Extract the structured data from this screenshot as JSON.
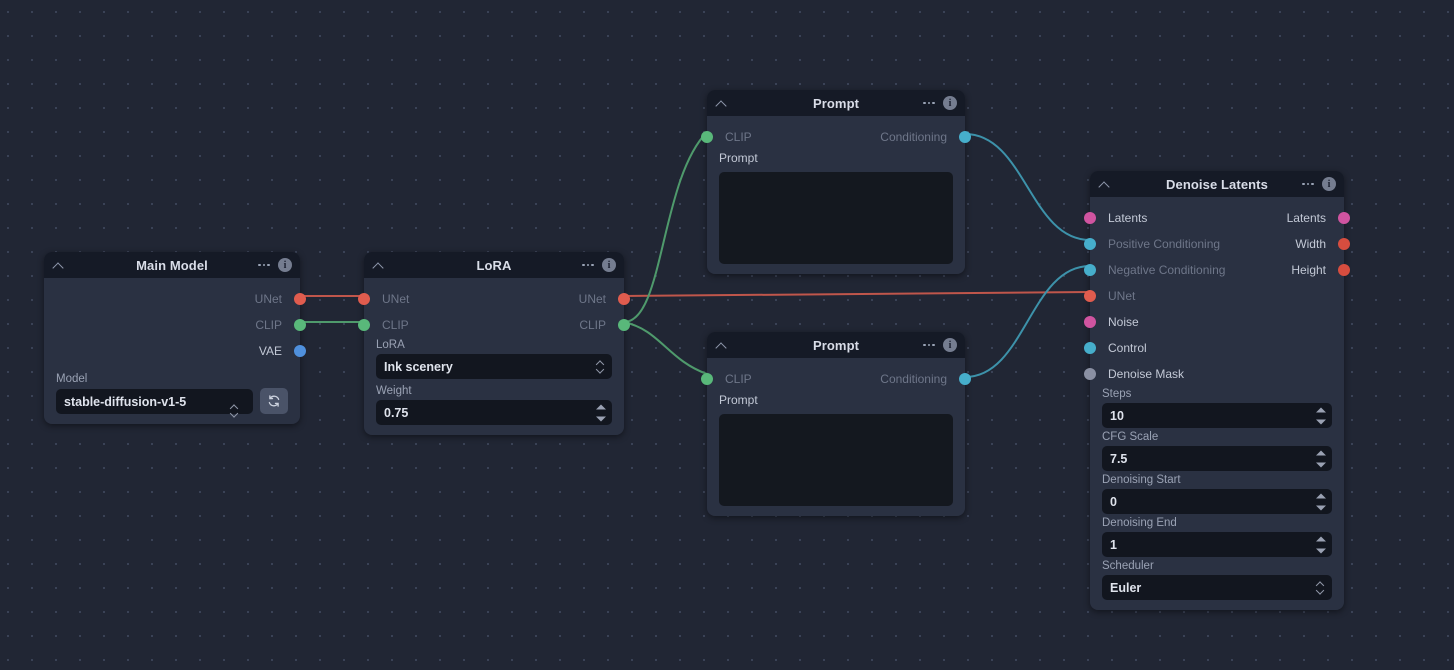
{
  "canvas": {
    "background_color": "#212634",
    "grid_dot_color": "#3a4256"
  },
  "socket_colors": {
    "unet": "#e05c4e",
    "clip": "#59b87a",
    "vae": "#4f90dd",
    "conditioning": "#46aecb",
    "latents": "#d054a0",
    "number": "#e3a94f",
    "grey": "#8a90a3"
  },
  "nodes": {
    "main_model": {
      "title": "Main Model",
      "collapse_icon": "chevron-up-icon",
      "menu_icon": "ellipsis-icon",
      "info_icon": "info-icon",
      "outputs": [
        {
          "label": "UNet",
          "color_key": "unet"
        },
        {
          "label": "CLIP",
          "color_key": "clip"
        },
        {
          "label": "VAE",
          "color_key": "vae"
        }
      ],
      "fields": [
        {
          "label": "Model",
          "value": "stable-diffusion-v1-5",
          "type": "select",
          "refresh_icon": "refresh-icon"
        }
      ]
    },
    "lora": {
      "title": "LoRA",
      "collapse_icon": "chevron-up-icon",
      "menu_icon": "ellipsis-icon",
      "info_icon": "info-icon",
      "inputs": [
        {
          "label": "UNet",
          "color_key": "unet"
        },
        {
          "label": "CLIP",
          "color_key": "clip"
        }
      ],
      "outputs": [
        {
          "label": "UNet",
          "color_key": "unet"
        },
        {
          "label": "CLIP",
          "color_key": "clip"
        }
      ],
      "fields": [
        {
          "label": "LoRA",
          "value": "Ink scenery",
          "type": "select"
        },
        {
          "label": "Weight",
          "value": "0.75",
          "type": "number"
        }
      ]
    },
    "prompt_positive": {
      "title": "Prompt",
      "collapse_icon": "chevron-up-icon",
      "menu_icon": "ellipsis-icon",
      "info_icon": "info-icon",
      "inputs": [
        {
          "label": "CLIP",
          "color_key": "clip"
        }
      ],
      "outputs": [
        {
          "label": "Conditioning",
          "color_key": "conditioning"
        }
      ],
      "fields": [
        {
          "label": "Prompt",
          "value": "",
          "type": "textarea"
        }
      ]
    },
    "prompt_negative": {
      "title": "Prompt",
      "collapse_icon": "chevron-up-icon",
      "menu_icon": "ellipsis-icon",
      "info_icon": "info-icon",
      "inputs": [
        {
          "label": "CLIP",
          "color_key": "clip"
        }
      ],
      "outputs": [
        {
          "label": "Conditioning",
          "color_key": "conditioning"
        }
      ],
      "fields": [
        {
          "label": "Prompt",
          "value": "",
          "type": "textarea"
        }
      ]
    },
    "denoise_latents": {
      "title": "Denoise Latents",
      "collapse_icon": "chevron-up-icon",
      "menu_icon": "ellipsis-icon",
      "info_icon": "info-icon",
      "inputs": [
        {
          "label": "Latents",
          "color_key": "latents"
        },
        {
          "label": "Positive Conditioning",
          "color_key": "conditioning"
        },
        {
          "label": "Negative Conditioning",
          "color_key": "conditioning"
        },
        {
          "label": "UNet",
          "color_key": "unet"
        },
        {
          "label": "Noise",
          "color_key": "latents"
        },
        {
          "label": "Control",
          "color_key": "conditioning"
        },
        {
          "label": "Denoise Mask",
          "color_key": "grey"
        }
      ],
      "outputs": [
        {
          "label": "Latents",
          "color_key": "latents"
        },
        {
          "label": "Width",
          "color_key": "unet"
        },
        {
          "label": "Height",
          "color_key": "unet"
        }
      ],
      "fields": [
        {
          "label": "Steps",
          "value": "10",
          "type": "number",
          "color_key": "unet"
        },
        {
          "label": "CFG Scale",
          "value": "7.5",
          "type": "number",
          "color_key": "number"
        },
        {
          "label": "Denoising Start",
          "value": "0",
          "type": "number",
          "color_key": "number"
        },
        {
          "label": "Denoising End",
          "value": "1",
          "type": "number",
          "color_key": "number"
        },
        {
          "label": "Scheduler",
          "value": "Euler",
          "type": "select",
          "color_key": "grey"
        }
      ]
    }
  }
}
